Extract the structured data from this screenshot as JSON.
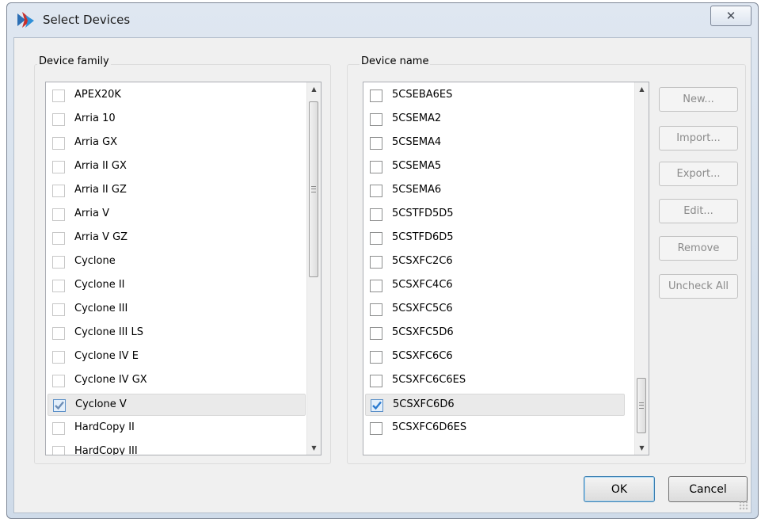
{
  "window": {
    "title": "Select Devices",
    "close_glyph": "✕"
  },
  "device_family": {
    "group_label": "Device family",
    "items": [
      {
        "label": "APEX20K",
        "checked": false
      },
      {
        "label": "Arria 10",
        "checked": false
      },
      {
        "label": "Arria GX",
        "checked": false
      },
      {
        "label": "Arria II GX",
        "checked": false
      },
      {
        "label": "Arria II GZ",
        "checked": false
      },
      {
        "label": "Arria V",
        "checked": false
      },
      {
        "label": "Arria V GZ",
        "checked": false
      },
      {
        "label": "Cyclone",
        "checked": false
      },
      {
        "label": "Cyclone II",
        "checked": false
      },
      {
        "label": "Cyclone III",
        "checked": false
      },
      {
        "label": "Cyclone III LS",
        "checked": false
      },
      {
        "label": "Cyclone IV E",
        "checked": false
      },
      {
        "label": "Cyclone IV GX",
        "checked": false
      },
      {
        "label": "Cyclone V",
        "checked": true,
        "selected": true
      },
      {
        "label": "HardCopy II",
        "checked": false
      },
      {
        "label": "HardCopy III",
        "checked": false
      }
    ]
  },
  "device_name": {
    "group_label": "Device name",
    "items": [
      {
        "label": "5CSEBA6ES",
        "checked": false
      },
      {
        "label": "5CSEMA2",
        "checked": false
      },
      {
        "label": "5CSEMA4",
        "checked": false
      },
      {
        "label": "5CSEMA5",
        "checked": false
      },
      {
        "label": "5CSEMA6",
        "checked": false
      },
      {
        "label": "5CSTFD5D5",
        "checked": false
      },
      {
        "label": "5CSTFD6D5",
        "checked": false
      },
      {
        "label": "5CSXFC2C6",
        "checked": false
      },
      {
        "label": "5CSXFC4C6",
        "checked": false
      },
      {
        "label": "5CSXFC5C6",
        "checked": false
      },
      {
        "label": "5CSXFC5D6",
        "checked": false
      },
      {
        "label": "5CSXFC6C6",
        "checked": false
      },
      {
        "label": "5CSXFC6C6ES",
        "checked": false
      },
      {
        "label": "5CSXFC6D6",
        "checked": true,
        "selected": true
      },
      {
        "label": "5CSXFC6D6ES",
        "checked": false
      }
    ]
  },
  "side_buttons": {
    "new": "New...",
    "import": "Import...",
    "export": "Export...",
    "edit": "Edit...",
    "remove": "Remove",
    "uncheck_all": "Uncheck All"
  },
  "dialog_buttons": {
    "ok": "OK",
    "cancel": "Cancel"
  },
  "scroll": {
    "up_glyph": "▲",
    "down_glyph": "▼"
  }
}
